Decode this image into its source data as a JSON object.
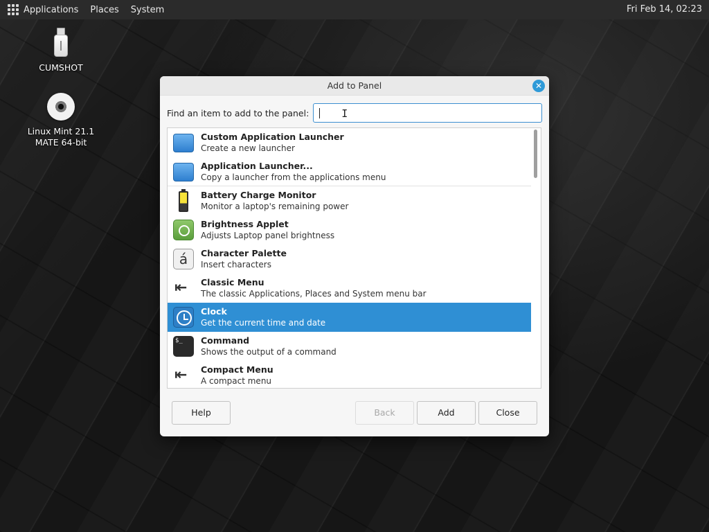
{
  "top_panel": {
    "menu": [
      "Applications",
      "Places",
      "System"
    ],
    "clock": "Fri Feb 14, 02:23"
  },
  "desktop": {
    "icons": [
      {
        "label": "CUMSHOT",
        "icon": "usb-drive-icon"
      },
      {
        "label": "Linux Mint 21.1 MATE 64-bit",
        "icon": "optical-disc-icon"
      }
    ]
  },
  "dialog": {
    "title": "Add to Panel",
    "find_label": "Find an item to add to the panel:",
    "search_value": "",
    "items": [
      {
        "name": "Custom Application Launcher",
        "desc": "Create a new launcher",
        "icon": "launcher-icon"
      },
      {
        "name": "Application Launcher...",
        "desc": "Copy a launcher from the applications menu",
        "icon": "launcher-icon"
      },
      {
        "name": "Battery Charge Monitor",
        "desc": "Monitor a laptop's remaining power",
        "icon": "battery-icon"
      },
      {
        "name": "Brightness Applet",
        "desc": "Adjusts Laptop panel brightness",
        "icon": "brightness-icon"
      },
      {
        "name": "Character Palette",
        "desc": "Insert characters",
        "icon": "character-palette-icon"
      },
      {
        "name": "Classic Menu",
        "desc": "The classic Applications, Places and System menu bar",
        "icon": "menu-arrow-icon"
      },
      {
        "name": "Clock",
        "desc": "Get the current time and date",
        "icon": "clock-icon",
        "selected": true
      },
      {
        "name": "Command",
        "desc": "Shows the output of a command",
        "icon": "terminal-icon"
      },
      {
        "name": "Compact Menu",
        "desc": "A compact menu",
        "icon": "menu-arrow-icon"
      }
    ],
    "buttons": {
      "help": "Help",
      "back": "Back",
      "add": "Add",
      "close": "Close"
    }
  },
  "colors": {
    "selection": "#2f8fd4",
    "close_button": "#2e9ad8",
    "panel": "#2b2b2b"
  }
}
